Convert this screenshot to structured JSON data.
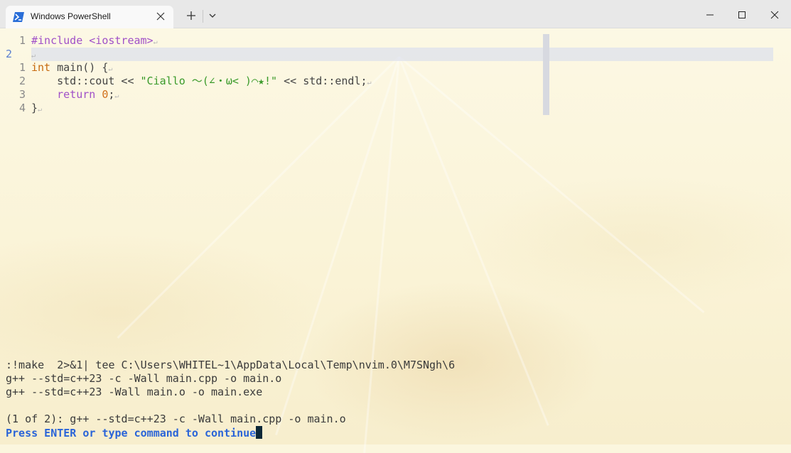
{
  "window": {
    "tab_title": "Windows PowerShell",
    "tab_icon": "powershell-icon",
    "controls": [
      "close-icon",
      "plus-icon",
      "chevron-down-icon",
      "minimize-icon",
      "maximize-icon",
      "close-icon"
    ]
  },
  "editor": {
    "line_numbers": [
      "1",
      "2",
      "1",
      "2",
      "3",
      "4"
    ],
    "lines": [
      {
        "parts": [
          {
            "t": "#include ",
            "c": "kw-pre"
          },
          {
            "t": "<iostream>",
            "c": "kw-inc"
          }
        ]
      },
      {
        "parts": []
      },
      {
        "parts": [
          {
            "t": "int",
            "c": "kw-type"
          },
          {
            "t": " main() {",
            "c": "op"
          }
        ]
      },
      {
        "parts": [
          {
            "t": "    std::cout << ",
            "c": "op"
          },
          {
            "t": "\"Ciallo ～(∠・ω< )⌒★!\"",
            "c": "str"
          },
          {
            "t": " << std::endl;",
            "c": "op"
          }
        ]
      },
      {
        "parts": [
          {
            "t": "    ",
            "c": "op"
          },
          {
            "t": "return",
            "c": "kw-ret"
          },
          {
            "t": " ",
            "c": "op"
          },
          {
            "t": "0",
            "c": "num"
          },
          {
            "t": ";",
            "c": "op"
          }
        ]
      },
      {
        "parts": [
          {
            "t": "}",
            "c": "op"
          }
        ]
      }
    ],
    "eol_marker": "↵"
  },
  "output": {
    "line1": ":!make  2>&1| tee C:\\Users\\WHITEL~1\\AppData\\Local\\Temp\\nvim.0\\M7SNgh\\6",
    "line2": "g++ --std=c++23 -c -Wall main.cpp -o main.o",
    "line3": "g++ --std=c++23 -Wall main.o -o main.exe",
    "line4": "(1 of 2): g++ --std=c++23 -c -Wall main.cpp -o main.o",
    "prompt": "Press ENTER or type command to continue"
  }
}
